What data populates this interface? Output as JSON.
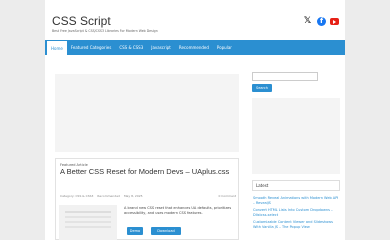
{
  "site": {
    "title": "CSS Script",
    "tagline": "Best Free JavaScript & CSS/CSS3 Libraries For Modern Web Design"
  },
  "social": {
    "x_label": "𝕏",
    "facebook_label": "f",
    "x_icon": "x-icon",
    "facebook_icon": "facebook-icon",
    "youtube_icon": "youtube-icon"
  },
  "nav": {
    "items": [
      {
        "label": "Home",
        "active": true
      },
      {
        "label": "Featured Categories"
      },
      {
        "label": "CSS & CSS3"
      },
      {
        "label": "Javascript"
      },
      {
        "label": "Recommended"
      },
      {
        "label": "Popular"
      }
    ]
  },
  "article": {
    "label": "Featured Article",
    "title": "A Better CSS Reset for Modern Devs – UAplus.css",
    "categories": "Category: CSS & CSS3",
    "recommended": "Recommended",
    "date": "May 8, 2025",
    "comments": "0 Comment",
    "excerpt": "A brand new CSS reset that enhances UA defaults, prioritizes accessibility, and uses modern CSS features.",
    "demo_label": "Demo",
    "download_label": "Download"
  },
  "sidebar": {
    "search_button": "Search",
    "latest_title": "Latest",
    "latest_items": [
      "Smooth Reveal Animations with Modern Web API – RevealJS",
      "Convert HTML Lists Into Custom Dropdowns – Dlistcss-select",
      "Customizable Content Viewer and Slideshows With Vanilla JS – The Popup View"
    ]
  },
  "colors": {
    "accent": "#2b8fd1",
    "background": "#ececec",
    "facebook": "#1877f2",
    "youtube": "#e62117"
  }
}
